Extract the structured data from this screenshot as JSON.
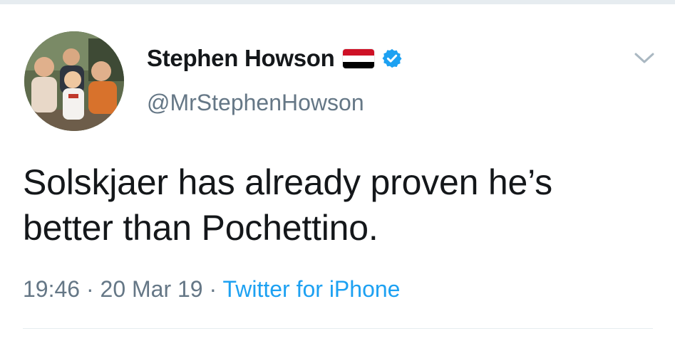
{
  "tweet": {
    "author": {
      "display_name": "Stephen Howson",
      "handle": "@MrStephenHowson",
      "verified": true,
      "flag": {
        "icon": "yemen-flag-icon",
        "colors": [
          "#ce1126",
          "#ffffff",
          "#000000"
        ]
      },
      "avatar": "group-photo-avatar"
    },
    "text_line_1": "Solskjaer has already proven he’s",
    "text_line_2": "better than Pochettino.",
    "time": "19:46",
    "separator": " · ",
    "date": "20 Mar 19",
    "source": "Twitter for iPhone",
    "menu_icon": "chevron-down-icon"
  },
  "colors": {
    "text_primary": "#14171a",
    "text_secondary": "#657786",
    "link": "#1da1f2",
    "verified": "#1da1f2",
    "divider": "#e6ecf0"
  }
}
